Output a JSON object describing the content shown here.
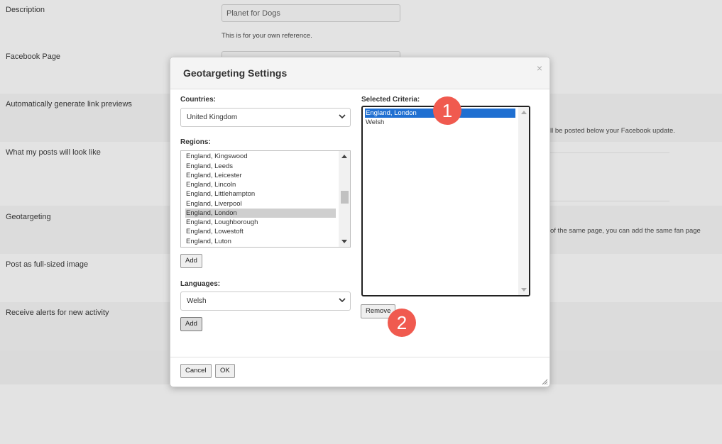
{
  "background": {
    "rows": [
      {
        "label": "Description"
      },
      {
        "label": "Facebook Page"
      },
      {
        "label": "Automatically generate link previews"
      },
      {
        "label": "What my posts will look like"
      },
      {
        "label": "Geotargeting"
      },
      {
        "label": "Post as full-sized image"
      },
      {
        "label": "Receive alerts for new activity"
      }
    ],
    "description_value": "Planet for Dogs",
    "description_help": "This is for your own reference.",
    "link_preview_help": "ll be posted below your Facebook update.",
    "geotargeting_help": "of the same page, you can add the same fan page"
  },
  "modal": {
    "title": "Geotargeting Settings",
    "close_glyph": "×",
    "countries_label": "Countries:",
    "country_selected": "United Kingdom",
    "regions_label": "Regions:",
    "regions": [
      "England, Kingswood",
      "England, Leeds",
      "England, Leicester",
      "England, Lincoln",
      "England, Littlehampton",
      "England, Liverpool",
      "England, London",
      "England, Loughborough",
      "England, Lowestoft",
      "England, Luton"
    ],
    "regions_selected": "England, London",
    "add_region_label": "Add",
    "languages_label": "Languages:",
    "language_selected": "Welsh",
    "add_language_label": "Add",
    "selected_criteria_label": "Selected Criteria:",
    "selected_criteria": [
      "England, London",
      "Welsh"
    ],
    "selected_criteria_active": "England, London",
    "remove_label": "Remove",
    "cancel_label": "Cancel",
    "ok_label": "OK"
  },
  "callouts": [
    "1",
    "2"
  ],
  "colors": {
    "accent_blue": "#1f6fd1",
    "callout_red": "#f05a4f"
  }
}
